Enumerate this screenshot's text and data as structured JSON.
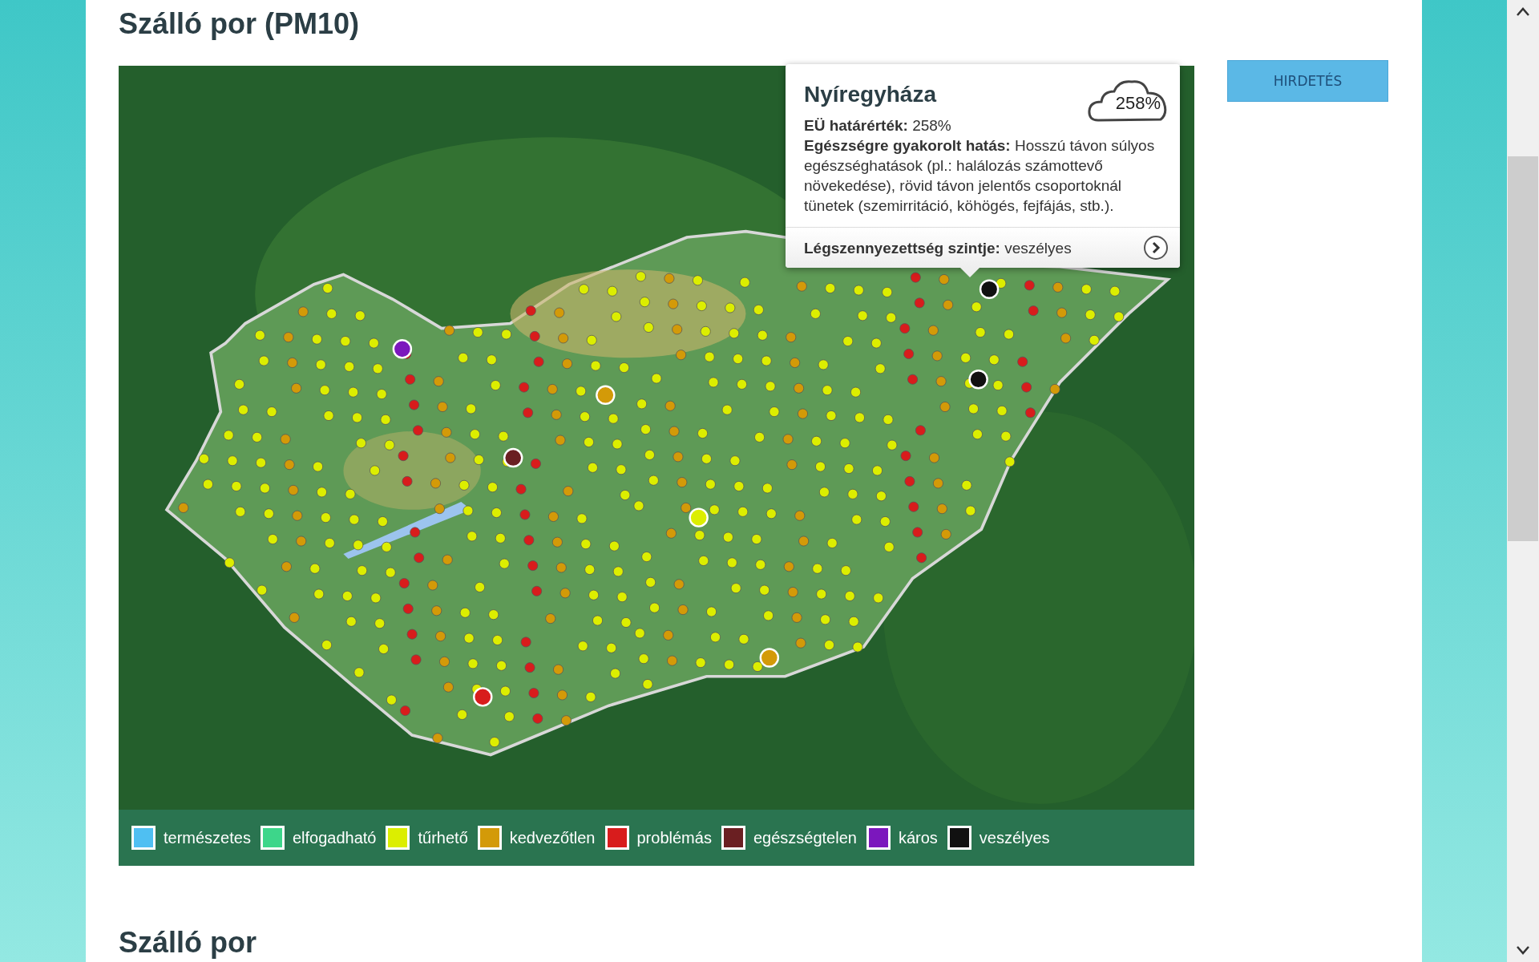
{
  "page_title": "Szálló por (PM10)",
  "tooltip": {
    "city": "Nyíregyháza",
    "badge": "258%",
    "limit": "**EÜ határérték:** 258%",
    "effect": "**Egészségre gyakorolt hatás:** Hosszú távon súlyos egészséghatások (pl.: halálozás számottevő növekedése), rövid távon jelentős csoportoknál tünetek (szemirritáció, köhögés, fejfájás, stb.).",
    "level": "**Légszennyezettség szintje:** veszélyes"
  },
  "legend": [
    {
      "label": "természetes",
      "color": "#4fbff2"
    },
    {
      "label": "elfogadható",
      "color": "#3dd68a"
    },
    {
      "label": "tűrhető",
      "color": "#dcee00"
    },
    {
      "label": "kedvezőtlen",
      "color": "#d39a08"
    },
    {
      "label": "problémás",
      "color": "#d81c1c"
    },
    {
      "label": "egészségtelen",
      "color": "#6a1f22"
    },
    {
      "label": "káros",
      "color": "#7b17bd"
    },
    {
      "label": "veszélyes",
      "color": "#111111"
    }
  ],
  "ad_button": "HIRDETÉS",
  "next_title": "Szálló por"
}
